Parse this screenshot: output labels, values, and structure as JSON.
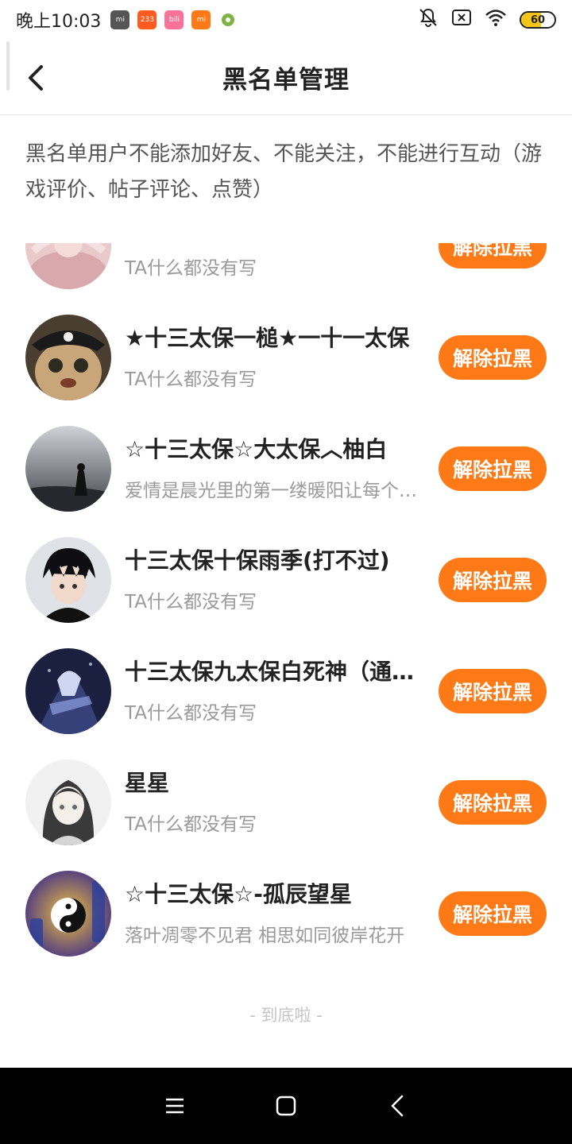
{
  "status_bar": {
    "time": "晚上10:03",
    "app_icons": [
      {
        "name": "mi-app-icon",
        "label": "mi",
        "color": "#555555"
      },
      {
        "name": "app-233-icon",
        "label": "233",
        "color": "#ff5a1f"
      },
      {
        "name": "bilibili-icon",
        "label": "bili",
        "color": "#fb7299"
      },
      {
        "name": "mi-store-icon",
        "label": "mi",
        "color": "#ff7a16"
      },
      {
        "name": "settings-app-icon",
        "label": "",
        "color": "#7cb342"
      }
    ],
    "battery_level": 60,
    "battery_text": "60"
  },
  "header": {
    "title": "黑名单管理"
  },
  "description": "黑名单用户不能添加好友、不能关注，不能进行互动（游戏评价、帖子评论、点赞）",
  "list": {
    "button_label": "解除拉黑",
    "users": [
      {
        "name": "",
        "bio": "TA什么都没有写",
        "avatar": "pink-photo"
      },
      {
        "name": "★十三太保一槌★一十一太保",
        "bio": "TA什么都没有写",
        "avatar": "pirate-cat"
      },
      {
        "name": "☆十三太保☆大太保︿柚白",
        "bio": "爱情是晨光里的第一缕暖阳让每个人都心生向往",
        "avatar": "dark-sky"
      },
      {
        "name": "十三太保十保雨季(打不过)",
        "bio": "TA什么都没有写",
        "avatar": "anime-boy"
      },
      {
        "name": "十三太保九太保白死神（通天之路）",
        "bio": "TA什么都没有写",
        "avatar": "night-warrior"
      },
      {
        "name": "星星",
        "bio": "TA什么都没有写",
        "avatar": "anime-girl"
      },
      {
        "name": "☆十三太保☆-孤辰望星",
        "bio": "落叶凋零不见君 相思如同彼岸花开",
        "avatar": "yin-yang"
      }
    ]
  },
  "end_text": "- 到底啦 -",
  "colors": {
    "accent": "#ff7a16",
    "title_text": "#222222",
    "secondary_text": "#9a9a9a"
  }
}
